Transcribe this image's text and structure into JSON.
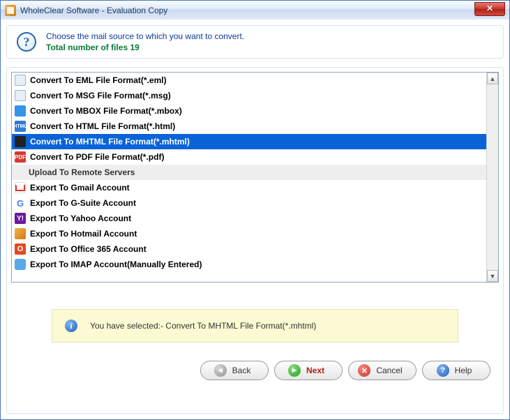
{
  "window": {
    "title": "WholeClear Software - Evaluation Copy",
    "close_symbol": "✕"
  },
  "header": {
    "help_symbol": "?",
    "instruction": "Choose the mail source to which you want to convert.",
    "total_label": "Total number of files 19"
  },
  "list": {
    "items": [
      {
        "label": "Convert To EML File Format(*.eml)",
        "icon_class": "icon-eml",
        "icon_text": "",
        "selected": false
      },
      {
        "label": "Convert To MSG File Format(*.msg)",
        "icon_class": "icon-msg",
        "icon_text": "",
        "selected": false
      },
      {
        "label": "Convert To MBOX File Format(*.mbox)",
        "icon_class": "icon-mbox",
        "icon_text": "",
        "selected": false
      },
      {
        "label": "Convert To HTML File Format(*.html)",
        "icon_class": "icon-html",
        "icon_text": "HTML",
        "selected": false
      },
      {
        "label": "Convert To MHTML File Format(*.mhtml)",
        "icon_class": "icon-mhtml",
        "icon_text": "",
        "selected": true
      },
      {
        "label": "Convert To PDF File Format(*.pdf)",
        "icon_class": "icon-pdf",
        "icon_text": "PDF",
        "selected": false
      }
    ],
    "section_header": "Upload To Remote Servers",
    "items2": [
      {
        "label": "Export To Gmail Account",
        "icon_class": "icon-gmail",
        "icon_text": "",
        "selected": false
      },
      {
        "label": "Export To G-Suite Account",
        "icon_class": "icon-gsuite",
        "icon_text": "G",
        "selected": false
      },
      {
        "label": "Export To Yahoo Account",
        "icon_class": "icon-yahoo",
        "icon_text": "Y!",
        "selected": false
      },
      {
        "label": "Export To Hotmail Account",
        "icon_class": "icon-hotmail",
        "icon_text": "",
        "selected": false
      },
      {
        "label": "Export To Office 365 Account",
        "icon_class": "icon-o365",
        "icon_text": "O",
        "selected": false
      },
      {
        "label": "Export To IMAP Account(Manually Entered)",
        "icon_class": "icon-imap",
        "icon_text": "",
        "selected": false
      }
    ],
    "scroll_up": "▲",
    "scroll_down": "▼"
  },
  "status": {
    "info_symbol": "i",
    "text": "You have selected:- Convert To MHTML File Format(*.mhtml)"
  },
  "buttons": {
    "back": "Back",
    "next": "Next",
    "cancel": "Cancel",
    "help": "Help",
    "back_icon": "◄",
    "next_icon": "►",
    "cancel_icon": "✕",
    "help_icon": "?"
  }
}
